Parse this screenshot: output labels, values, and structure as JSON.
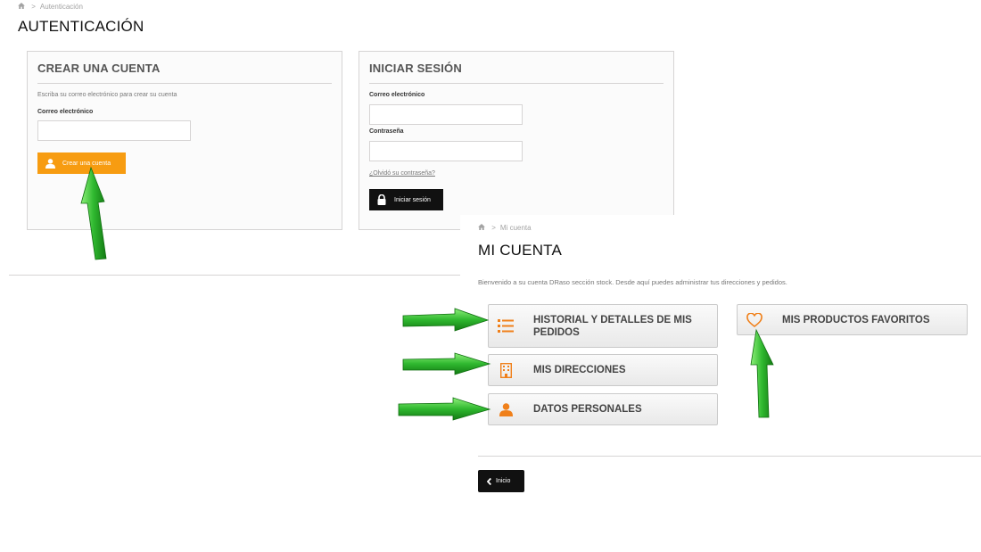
{
  "auth": {
    "breadcrumb": {
      "current": "Autenticación"
    },
    "title": "AUTENTICACIÓN",
    "create": {
      "title": "CREAR UNA CUENTA",
      "hint": "Escriba su correo electrónico para crear su cuenta",
      "email_label": "Correo electrónico",
      "button_label": "Crear una cuenta"
    },
    "login": {
      "title": "INICIAR SESIÓN",
      "email_label": "Correo electrónico",
      "password_label": "Contraseña",
      "forgot_link": "¿Olvidó su contraseña?",
      "button_label": "Iniciar sesión"
    }
  },
  "account": {
    "breadcrumb": {
      "current": "Mi cuenta"
    },
    "title": "MI CUENTA",
    "welcome": "Bienvenido a su cuenta DRaso sección stock. Desde aquí puedes administrar tus direcciones y pedidos.",
    "buttons": {
      "history": "HISTORIAL Y DETALLES DE MIS PEDIDOS",
      "addresses": "MIS DIRECCIONES",
      "personal": "DATOS PERSONALES",
      "favorites": "MIS PRODUCTOS FAVORITOS"
    },
    "home_button": "Inicio"
  },
  "icons": {
    "home": "home-icon",
    "user": "user-icon",
    "lock": "lock-icon",
    "list": "list-icon",
    "building": "building-icon",
    "heart": "heart-icon",
    "chevron_left": "chevron-left-icon",
    "arrow": "green-arrow-icon"
  },
  "colors": {
    "accent_orange": "#f79c11",
    "dark_button": "#111111",
    "arrow_green": "#2db82d"
  }
}
